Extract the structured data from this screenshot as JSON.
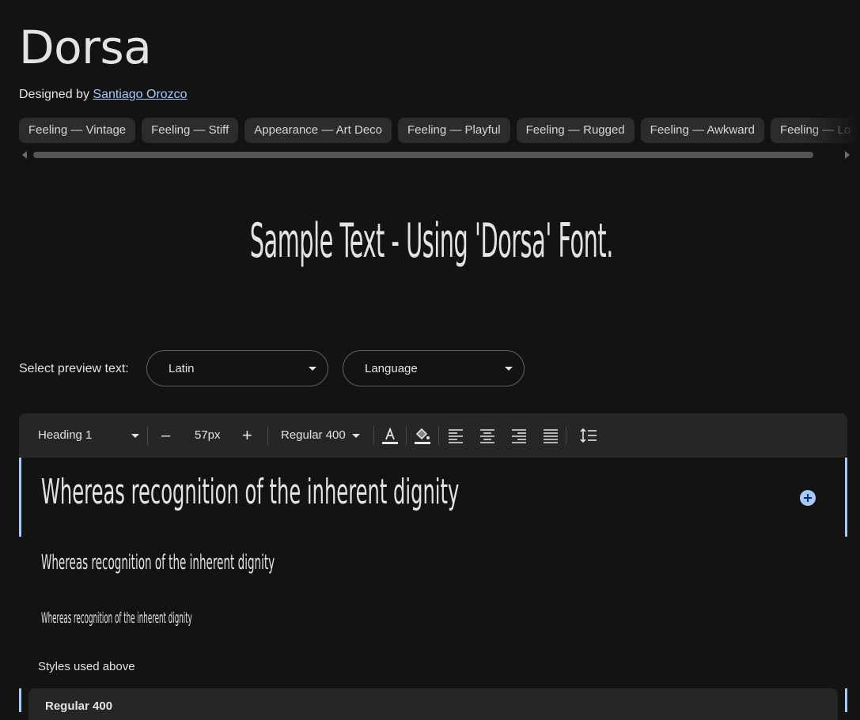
{
  "font": {
    "name": "Dorsa",
    "designed_by_prefix": "Designed by ",
    "designer": "Santiago Orozco"
  },
  "tags": [
    "Feeling — Vintage",
    "Feeling — Stiff",
    "Appearance — Art Deco",
    "Feeling — Playful",
    "Feeling — Rugged",
    "Feeling — Awkward",
    "Feeling — Lo"
  ],
  "sample_text": "Sample Text - Using 'Dorsa' Font.",
  "preview_controls": {
    "label": "Select preview text:",
    "script_select": "Latin",
    "language_select": "Language"
  },
  "toolbar": {
    "style_select": "Heading 1",
    "size_decrease": "–",
    "font_size": "57px",
    "size_increase": "+",
    "weight_select": "Regular 400"
  },
  "preview": {
    "line_1": "Whereas recognition of the inherent dignity",
    "line_2": "Whereas recognition of the inherent dignity",
    "line_3": "Whereas recognition of the inherent dignity"
  },
  "styles_section": {
    "title": "Styles used above",
    "first_style": "Regular 400"
  },
  "colors": {
    "background": "#131313",
    "accent": "#a8c7fa",
    "chip": "#2c2c2c",
    "toolbar": "#262626"
  }
}
